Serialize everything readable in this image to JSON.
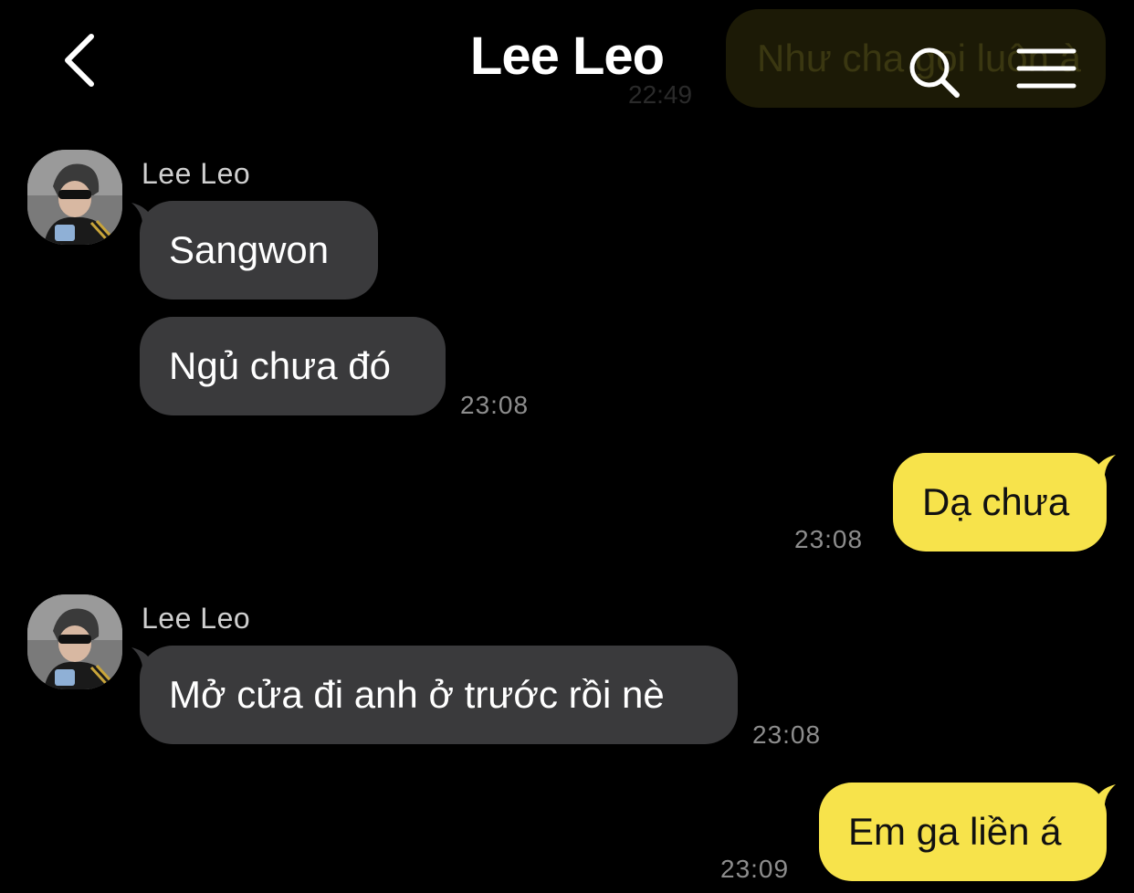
{
  "header": {
    "title": "Lee Leo",
    "back_icon": "chevron-left-icon",
    "search_icon": "search-icon",
    "menu_icon": "hamburger-menu-icon"
  },
  "previous_message": {
    "text": "Như cha gọi luôn à",
    "time": "22:49"
  },
  "messages": [
    {
      "sender": "Lee Leo",
      "text": "Sangwon",
      "direction": "incoming"
    },
    {
      "sender": "Lee Leo",
      "text": "Ngủ chưa đó",
      "direction": "incoming",
      "time": "23:08"
    },
    {
      "sender": "me",
      "text": "Dạ chưa",
      "direction": "outgoing",
      "time": "23:08"
    },
    {
      "sender": "Lee Leo",
      "text": "Mở cửa đi anh ở trước rồi nè",
      "direction": "incoming",
      "time": "23:08"
    },
    {
      "sender": "me",
      "text": "Em ga liền á",
      "direction": "outgoing",
      "time": "23:09"
    }
  ],
  "colors": {
    "background": "#000000",
    "incoming_bubble": "#3a3a3c",
    "outgoing_bubble": "#f7e34b",
    "timestamp": "#8d8d8d"
  }
}
